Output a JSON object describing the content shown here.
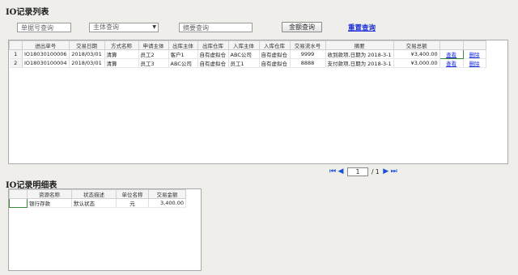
{
  "list_title": "IO记录列表",
  "detail_title": "IO记录明细表",
  "filters": {
    "bill_no_placeholder": "单据号查询",
    "subject_placeholder": "主体查询",
    "summary_placeholder": "摘要查询",
    "amount_button": "金额查询",
    "reset_link": "重置查询"
  },
  "list_table": {
    "columns": [
      "进出单号",
      "交易日期",
      "方式名称",
      "申请主体",
      "出库主体",
      "出库仓库",
      "入库主体",
      "入库仓库",
      "交易流水号",
      "摘要",
      "交易总额",
      "",
      ""
    ],
    "rows": [
      {
        "no": "1",
        "bill": "IO18030100006",
        "date": "2018/03/01",
        "method": "清算",
        "applicant": "员工2",
        "out_subject": "客户1",
        "out_wh": "自有虚拟仓",
        "in_subject": "ABC公司",
        "in_wh": "自有虚拟仓",
        "serial": "9999",
        "summary": "收到款项,日期为 2018-3-1",
        "amount": "¥3,400.00",
        "view": "查看",
        "delete": "删除"
      },
      {
        "no": "2",
        "bill": "IO18030100004",
        "date": "2018/03/01",
        "method": "清算",
        "applicant": "员工3",
        "out_subject": "ABC公司",
        "out_wh": "自有虚拟仓",
        "in_subject": "员工1",
        "in_wh": "自有虚拟仓",
        "serial": "8888",
        "summary": "支付款项,日期为 2018-3-1",
        "amount": "¥3,000.00",
        "view": "查看",
        "delete": "删除"
      }
    ]
  },
  "pager": {
    "current": "1",
    "total": "/ 1"
  },
  "detail_table": {
    "columns": [
      "资源名称",
      "状态描述",
      "单位名称",
      "交易金额"
    ],
    "rows": [
      {
        "name": "银行存款",
        "status": "默认状态",
        "unit": "元",
        "amount": "3,400.00"
      }
    ]
  }
}
